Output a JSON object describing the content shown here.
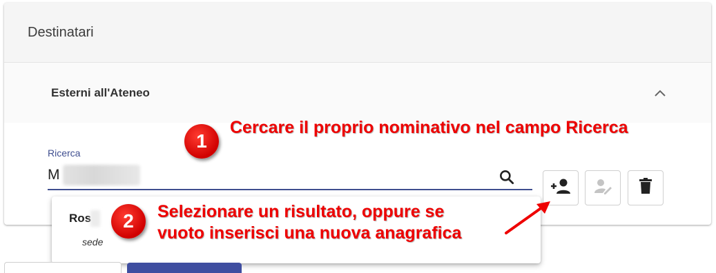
{
  "card": {
    "title": "Destinatari"
  },
  "section": {
    "title": "Esterni all'Ateneo"
  },
  "search": {
    "label": "Ricerca",
    "value_visible": "M"
  },
  "dropdown": {
    "result_name_visible": "Ros",
    "result_sub": "sede"
  },
  "annotations": {
    "step1": {
      "number": "1",
      "text": "Cercare il proprio nominativo nel campo Ricerca"
    },
    "step2": {
      "number": "2",
      "line1": "Selezionare un risultato, oppure se",
      "line2": "vuoto inserisci una nuova anagrafica"
    }
  },
  "buttons": [
    {
      "name": "add-person-button",
      "icon": "person-add-icon",
      "enabled": true
    },
    {
      "name": "edit-person-button",
      "icon": "person-edit-icon",
      "enabled": false
    },
    {
      "name": "delete-button",
      "icon": "trash-icon",
      "enabled": true
    }
  ],
  "colors": {
    "accent": "#3f4e8f",
    "annotation_red": "#ee0000",
    "header_bg": "#f5f5f5",
    "primary_button": "#3f4ea0"
  }
}
